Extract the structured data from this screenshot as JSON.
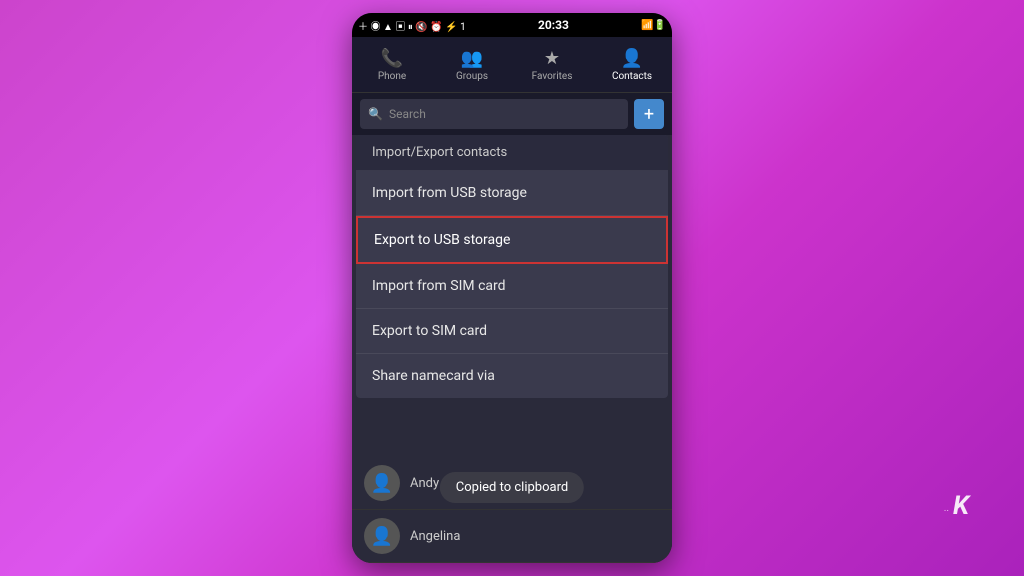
{
  "background": {
    "gradient_start": "#cc44cc",
    "gradient_end": "#aa22bb"
  },
  "status_bar": {
    "time": "20:33",
    "icons_left": [
      "＋",
      "◉",
      "▲",
      "▣",
      "⏸",
      "🔇",
      "⏰",
      "⚡",
      "1"
    ],
    "icons_right": [
      "📶",
      "🔋"
    ]
  },
  "tabs": [
    {
      "label": "Phone",
      "icon": "📞",
      "active": false
    },
    {
      "label": "Groups",
      "icon": "👥",
      "active": false
    },
    {
      "label": "Favorites",
      "icon": "★",
      "active": false
    },
    {
      "label": "Contacts",
      "icon": "👤",
      "active": true
    }
  ],
  "search": {
    "placeholder": "Search"
  },
  "menu": {
    "title": "Import/Export contacts",
    "items": [
      {
        "label": "Import from USB storage",
        "highlighted": false
      },
      {
        "label": "Export to USB storage",
        "highlighted": true
      },
      {
        "label": "Import from SIM card",
        "highlighted": false
      },
      {
        "label": "Export to SIM card",
        "highlighted": false
      },
      {
        "label": "Share namecard via",
        "highlighted": false
      }
    ]
  },
  "contacts": [
    {
      "name": "Andy"
    },
    {
      "name": "Angelina"
    }
  ],
  "toast": {
    "message": "Copied to clipboard"
  },
  "add_button_label": "+"
}
